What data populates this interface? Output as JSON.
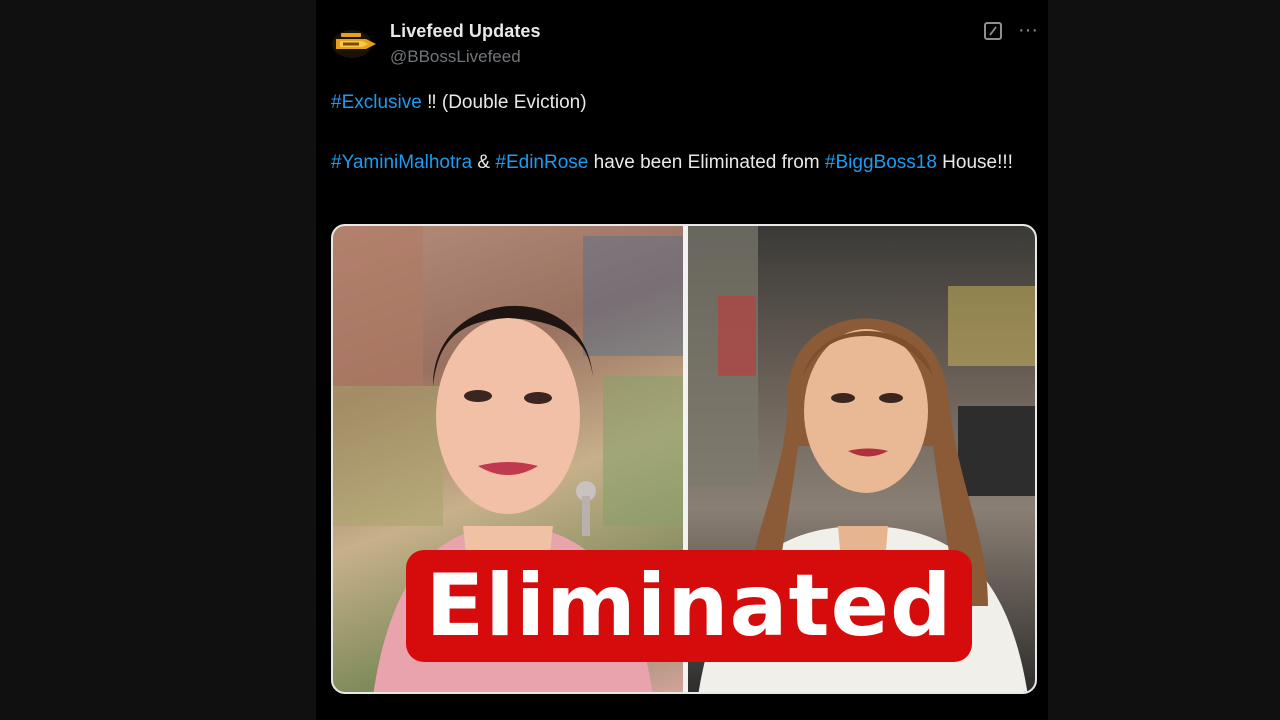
{
  "tweet": {
    "display_name": "Livefeed Updates",
    "handle": "@BBossLivefeed",
    "avatar_icon": "bigg-boss-logo-icon",
    "header_icons": [
      "grok-icon",
      "more-icon"
    ],
    "more_glyph": "···",
    "text": {
      "line1": {
        "hashtag": "#Exclusive",
        "rest": " ‼ (Double Eviction)"
      },
      "line2": {
        "hashtag1": "#YaminiMalhotra",
        "amp": " & ",
        "hashtag2": "#EdinRose",
        "middle": " have been Eliminated from ",
        "hashtag3": "#BiggBoss18",
        "end": " House!!!"
      }
    },
    "media": {
      "banner_text": "Eliminated",
      "banner_color": "#d60b0b"
    }
  },
  "colors": {
    "hashtag": "#1d9bf0",
    "background": "#000000",
    "text": "#e7e9ea",
    "secondary_text": "#71767b"
  }
}
